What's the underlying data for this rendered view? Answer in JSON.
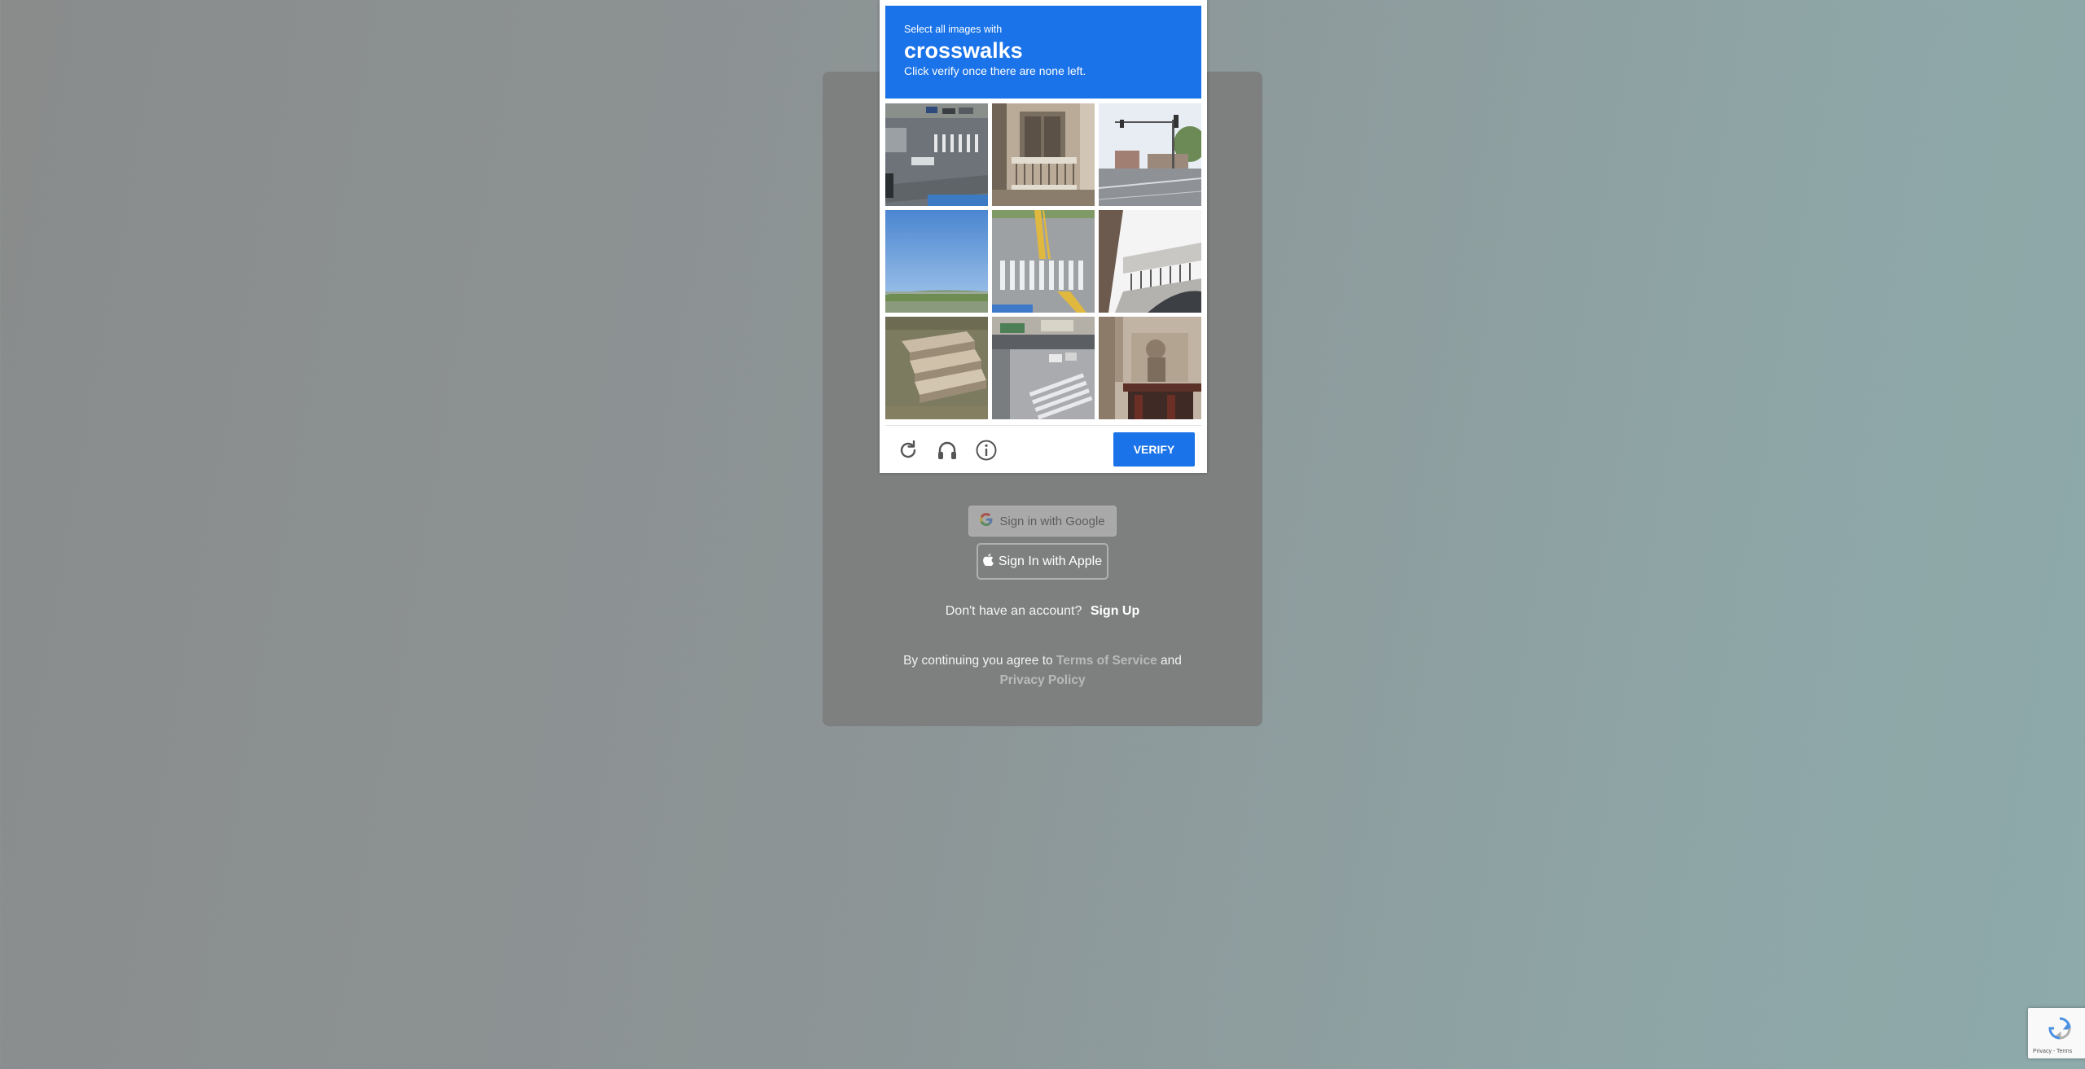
{
  "login": {
    "google_label": "Sign in with Google",
    "apple_label": "Sign In with Apple",
    "no_account_text": "Don't have an account?",
    "signup_link": "Sign Up",
    "legal_prefix": "By continuing you agree to",
    "terms_link": "Terms of Service",
    "legal_and": "and",
    "privacy_link": "Privacy Policy"
  },
  "captcha": {
    "instruction_small": "Select all images with",
    "target_word": "crosswalks",
    "instruction_sub": "Click verify once there are none left.",
    "verify_label": "VERIFY",
    "tiles": [
      "intersection with crosswalk",
      "building balcony",
      "street with traffic light",
      "blue sky and bridge",
      "road with crosswalk",
      "balcony from below",
      "stone steps",
      "street with crosswalk",
      "building facade"
    ],
    "icons": [
      "reload-icon",
      "headphones-icon",
      "info-icon"
    ]
  },
  "badge": {
    "terms": "Privacy - Terms"
  },
  "colors": {
    "accent": "#1a73e8",
    "card": "#7e8080"
  }
}
